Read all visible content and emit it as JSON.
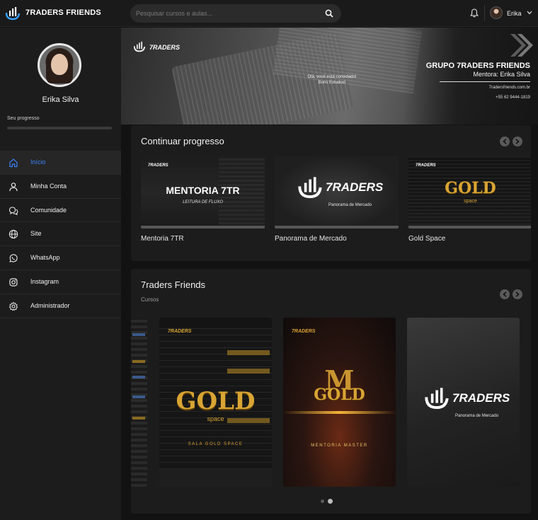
{
  "app": {
    "brand": "7RADERS FRIENDS"
  },
  "search": {
    "placeholder": "Pesquisar cursos e aulas..."
  },
  "user": {
    "name_short": "Erika"
  },
  "profile": {
    "name": "Erika Silva",
    "progress_label": "Seu progresso",
    "progress_fraction": 0.0
  },
  "sidebar": {
    "items": [
      {
        "label": "Início",
        "icon": "home-icon",
        "active": true
      },
      {
        "label": "Minha Conta",
        "icon": "user-icon",
        "active": false
      },
      {
        "label": "Comunidade",
        "icon": "chat-icon",
        "active": false
      },
      {
        "label": "Site",
        "icon": "globe-icon",
        "active": false
      },
      {
        "label": "WhatsApp",
        "icon": "whatsapp-icon",
        "active": false
      },
      {
        "label": "Instagram",
        "icon": "instagram-icon",
        "active": false
      },
      {
        "label": "Administrador",
        "icon": "gear-icon",
        "active": false
      }
    ]
  },
  "banner": {
    "logo": "7RADERS",
    "tagline": "Olá, você está convidado! Bons Estudos!",
    "title": "GRUPO 7RADERS FRIENDS",
    "subtitle": "Mentora: Erika Silva",
    "site": "7radersfriends.com.br",
    "phone": "+55 62 9444-1819"
  },
  "continue": {
    "title": "Continuar progresso",
    "items": [
      {
        "title": "Mentoria 7TR",
        "thumb_logo": "7RADERS",
        "thumb_heading": "MENTORIA 7TR",
        "thumb_sub": "LEITURA DE FLUXO"
      },
      {
        "title": "Panorama de Mercado",
        "thumb_logo": "7RADERS",
        "thumb_sub": "Panorama de Mercado"
      },
      {
        "title": "Gold Space",
        "thumb_logo": "7RADERS",
        "thumb_heading": "GOLD",
        "thumb_sub": "space"
      }
    ]
  },
  "courses": {
    "title": "7raders Friends",
    "subtitle": "Cursos",
    "posters": [
      {
        "logo": "7RADERS",
        "heading": "GOLD",
        "sub": "space",
        "caption": "SALA GOLD SPACE"
      },
      {
        "logo": "7RADERS",
        "monogram": "M",
        "heading": "GOLD",
        "caption": "MENTORIA MASTER"
      },
      {
        "logo": "7RADERS",
        "sub": "Panorama de Mercado"
      }
    ]
  },
  "colors": {
    "accent": "#3b82f6",
    "gold": "#d9a533",
    "bg": "#121212",
    "panel": "#1c1c1c"
  }
}
